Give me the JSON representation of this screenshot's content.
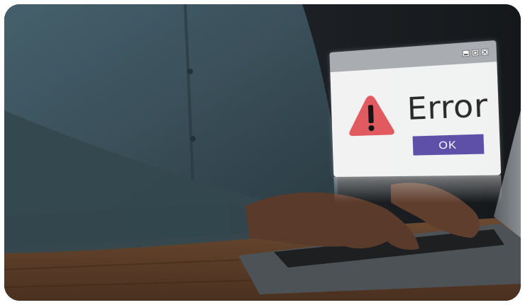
{
  "dialog": {
    "heading": "Error",
    "ok_label": "OK",
    "icon": "warning-triangle-icon",
    "window_controls": [
      "minimize-icon",
      "maximize-icon",
      "close-icon"
    ]
  },
  "colors": {
    "warning_red": "#e05a5f",
    "ok_button": "#5e4fa8",
    "titlebar": "#a9adb1",
    "shirt": "#3e525c",
    "desk": "#5a3c26"
  }
}
